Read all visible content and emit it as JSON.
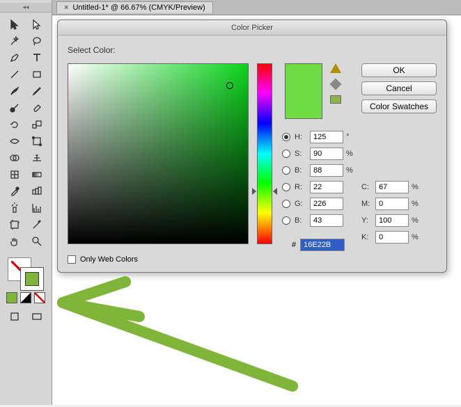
{
  "tab": {
    "title": "Untitled-1* @ 66.67% (CMYK/Preview)",
    "close": "×"
  },
  "dialog": {
    "title": "Color Picker",
    "select_label": "Select Color:",
    "ok": "OK",
    "cancel": "Cancel",
    "swatches": "Color Swatches",
    "web_only": "Only Web Colors",
    "hsb": {
      "h_label": "H:",
      "s_label": "S:",
      "b_label": "B:",
      "h": "125",
      "s": "90",
      "b": "88",
      "deg": "°",
      "pct": "%"
    },
    "rgb": {
      "r_label": "R:",
      "g_label": "G:",
      "b_label": "B:",
      "r": "22",
      "g": "226",
      "b": "43"
    },
    "hex": {
      "prefix": "#",
      "value": "16E22B"
    },
    "cmyk": {
      "c_label": "C:",
      "m_label": "M:",
      "y_label": "Y:",
      "k_label": "K:",
      "c": "67",
      "m": "0",
      "y": "100",
      "k": "0",
      "pct": "%"
    }
  },
  "toolbox_header": "◂◂"
}
